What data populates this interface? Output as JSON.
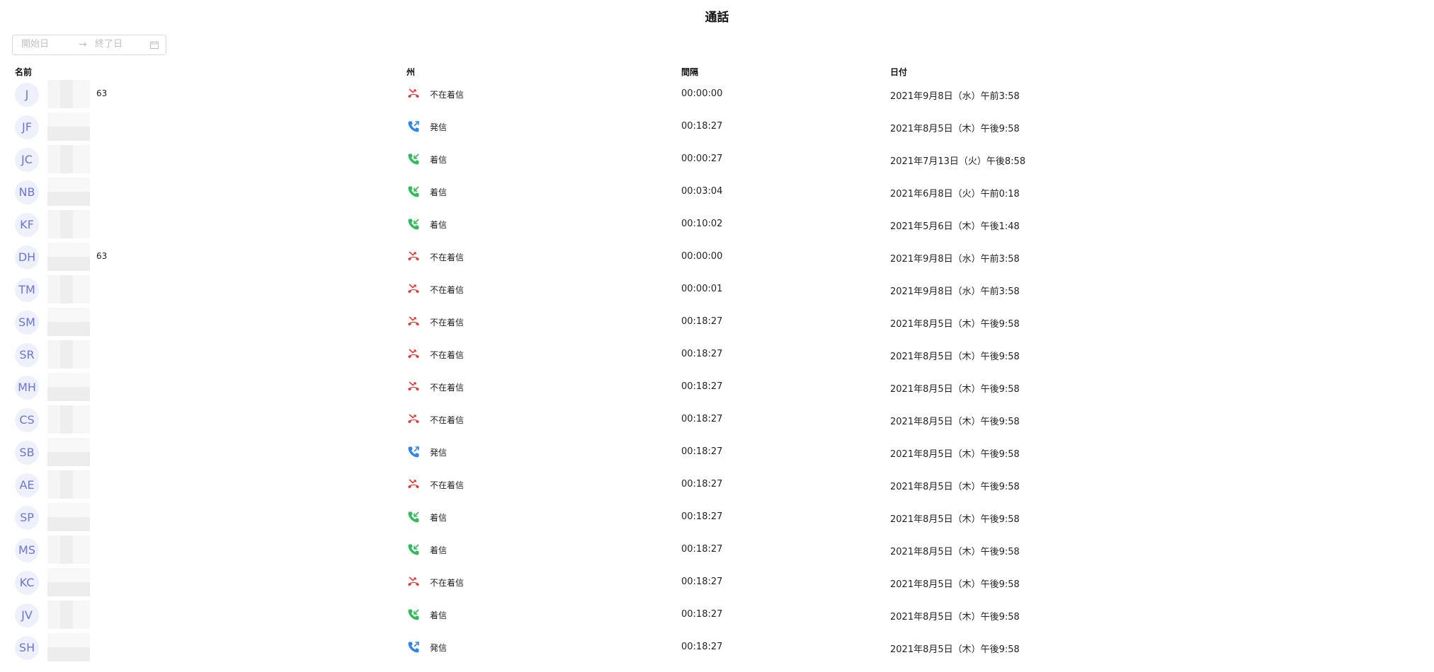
{
  "title": "通話",
  "date_range": {
    "start_placeholder": "開始日",
    "end_placeholder": "終了日",
    "arrow": "→",
    "calendar_icon": "calendar-icon"
  },
  "columns": {
    "name": "名前",
    "state": "州",
    "duration": "間隔",
    "date": "日付"
  },
  "colors": {
    "missed": "#e53935",
    "outgoing": "#2f86eb",
    "incoming": "#2ebd59",
    "avatar_bg": "#eef0fb",
    "avatar_text": "#6b74d8"
  },
  "rows": [
    {
      "initials": "J",
      "name_suffix": "63",
      "state": "不在着信",
      "type": "missed",
      "duration": "00:00:00",
      "date": "2021年9月8日（水）午前3:58"
    },
    {
      "initials": "JF",
      "name_suffix": "",
      "state": "発信",
      "type": "outgoing",
      "duration": "00:18:27",
      "date": "2021年8月5日（木）午後9:58"
    },
    {
      "initials": "JC",
      "name_suffix": "",
      "state": "着信",
      "type": "incoming",
      "duration": "00:00:27",
      "date": "2021年7月13日（火）午後8:58"
    },
    {
      "initials": "NB",
      "name_suffix": "",
      "state": "着信",
      "type": "incoming",
      "duration": "00:03:04",
      "date": "2021年6月8日（火）午前0:18"
    },
    {
      "initials": "KF",
      "name_suffix": "",
      "state": "着信",
      "type": "incoming",
      "duration": "00:10:02",
      "date": "2021年5月6日（木）午後1:48"
    },
    {
      "initials": "DH",
      "name_suffix": "63",
      "state": "不在着信",
      "type": "missed",
      "duration": "00:00:00",
      "date": "2021年9月8日（水）午前3:58"
    },
    {
      "initials": "TM",
      "name_suffix": "",
      "state": "不在着信",
      "type": "missed",
      "duration": "00:00:01",
      "date": "2021年9月8日（水）午前3:58"
    },
    {
      "initials": "SM",
      "name_suffix": "",
      "state": "不在着信",
      "type": "missed",
      "duration": "00:18:27",
      "date": "2021年8月5日（木）午後9:58"
    },
    {
      "initials": "SR",
      "name_suffix": "",
      "state": "不在着信",
      "type": "missed",
      "duration": "00:18:27",
      "date": "2021年8月5日（木）午後9:58"
    },
    {
      "initials": "MH",
      "name_suffix": "",
      "state": "不在着信",
      "type": "missed",
      "duration": "00:18:27",
      "date": "2021年8月5日（木）午後9:58"
    },
    {
      "initials": "CS",
      "name_suffix": "",
      "state": "不在着信",
      "type": "missed",
      "duration": "00:18:27",
      "date": "2021年8月5日（木）午後9:58"
    },
    {
      "initials": "SB",
      "name_suffix": "",
      "state": "発信",
      "type": "outgoing",
      "duration": "00:18:27",
      "date": "2021年8月5日（木）午後9:58"
    },
    {
      "initials": "AE",
      "name_suffix": "",
      "state": "不在着信",
      "type": "missed",
      "duration": "00:18:27",
      "date": "2021年8月5日（木）午後9:58"
    },
    {
      "initials": "SP",
      "name_suffix": "",
      "state": "着信",
      "type": "incoming",
      "duration": "00:18:27",
      "date": "2021年8月5日（木）午後9:58"
    },
    {
      "initials": "MS",
      "name_suffix": "",
      "state": "着信",
      "type": "incoming",
      "duration": "00:18:27",
      "date": "2021年8月5日（木）午後9:58"
    },
    {
      "initials": "KC",
      "name_suffix": "",
      "state": "不在着信",
      "type": "missed",
      "duration": "00:18:27",
      "date": "2021年8月5日（木）午後9:58"
    },
    {
      "initials": "JV",
      "name_suffix": "",
      "state": "着信",
      "type": "incoming",
      "duration": "00:18:27",
      "date": "2021年8月5日（木）午後9:58"
    },
    {
      "initials": "SH",
      "name_suffix": "",
      "state": "発信",
      "type": "outgoing",
      "duration": "00:18:27",
      "date": "2021年8月5日（木）午後9:58"
    }
  ]
}
